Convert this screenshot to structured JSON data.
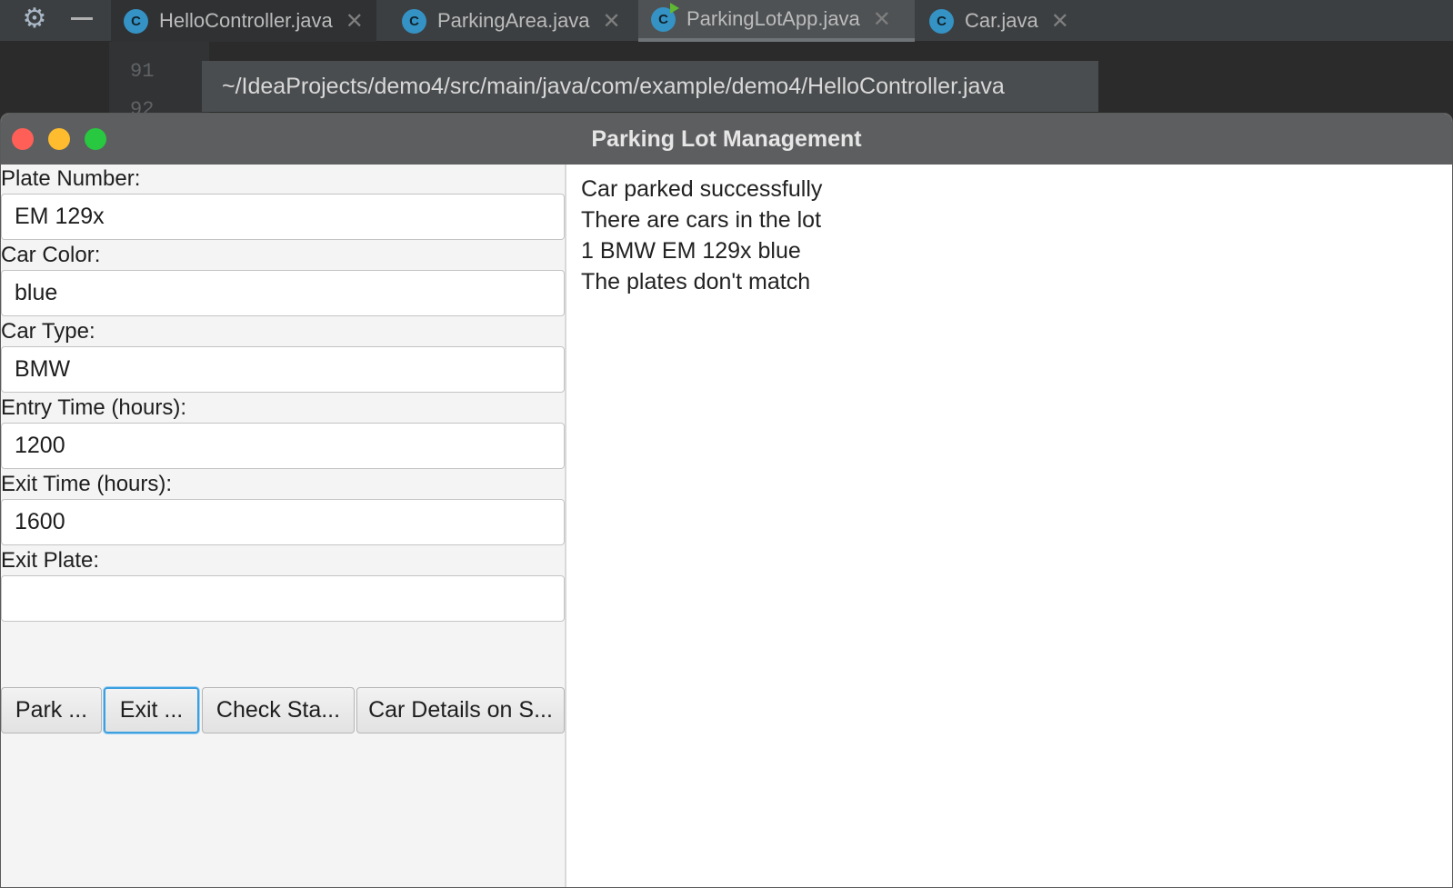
{
  "ide": {
    "tabs": [
      {
        "label": "HelloController.java",
        "icon": "class-icon"
      },
      {
        "label": "ParkingArea.java",
        "icon": "class-icon"
      },
      {
        "label": "ParkingLotApp.java",
        "icon": "class-run-icon"
      },
      {
        "label": "Car.java",
        "icon": "class-icon"
      }
    ],
    "icon_letter": "C",
    "close_glyph": "✕",
    "line_numbers": [
      "91",
      "92"
    ],
    "path_tooltip": "~/IdeaProjects/demo4/src/main/java/com/example/demo4/HelloController.java"
  },
  "window": {
    "title": "Parking Lot Management"
  },
  "form": {
    "plate_label": "Plate Number:",
    "plate_value": "EM 129x",
    "color_label": "Car Color:",
    "color_value": "blue",
    "type_label": "Car Type:",
    "type_value": "BMW",
    "entry_label": "Entry Time (hours):",
    "entry_value": "1200",
    "exit_label": "Exit Time (hours):",
    "exit_value": "1600",
    "exit_plate_label": "Exit Plate:",
    "exit_plate_value": ""
  },
  "buttons": {
    "park": "Park ...",
    "exit": "Exit ...",
    "check": "Check Sta...",
    "details": "Car Details on S..."
  },
  "output": [
    "Car parked successfully",
    "There are cars in the lot",
    "1 BMW EM 129x blue",
    "The plates don't match"
  ],
  "colors": {
    "focus_ring": "#3b9fe0",
    "tab_icon": "#3592c4",
    "close_red": "#ff5f57",
    "minimize_yellow": "#febc2e",
    "zoom_green": "#28c840"
  }
}
